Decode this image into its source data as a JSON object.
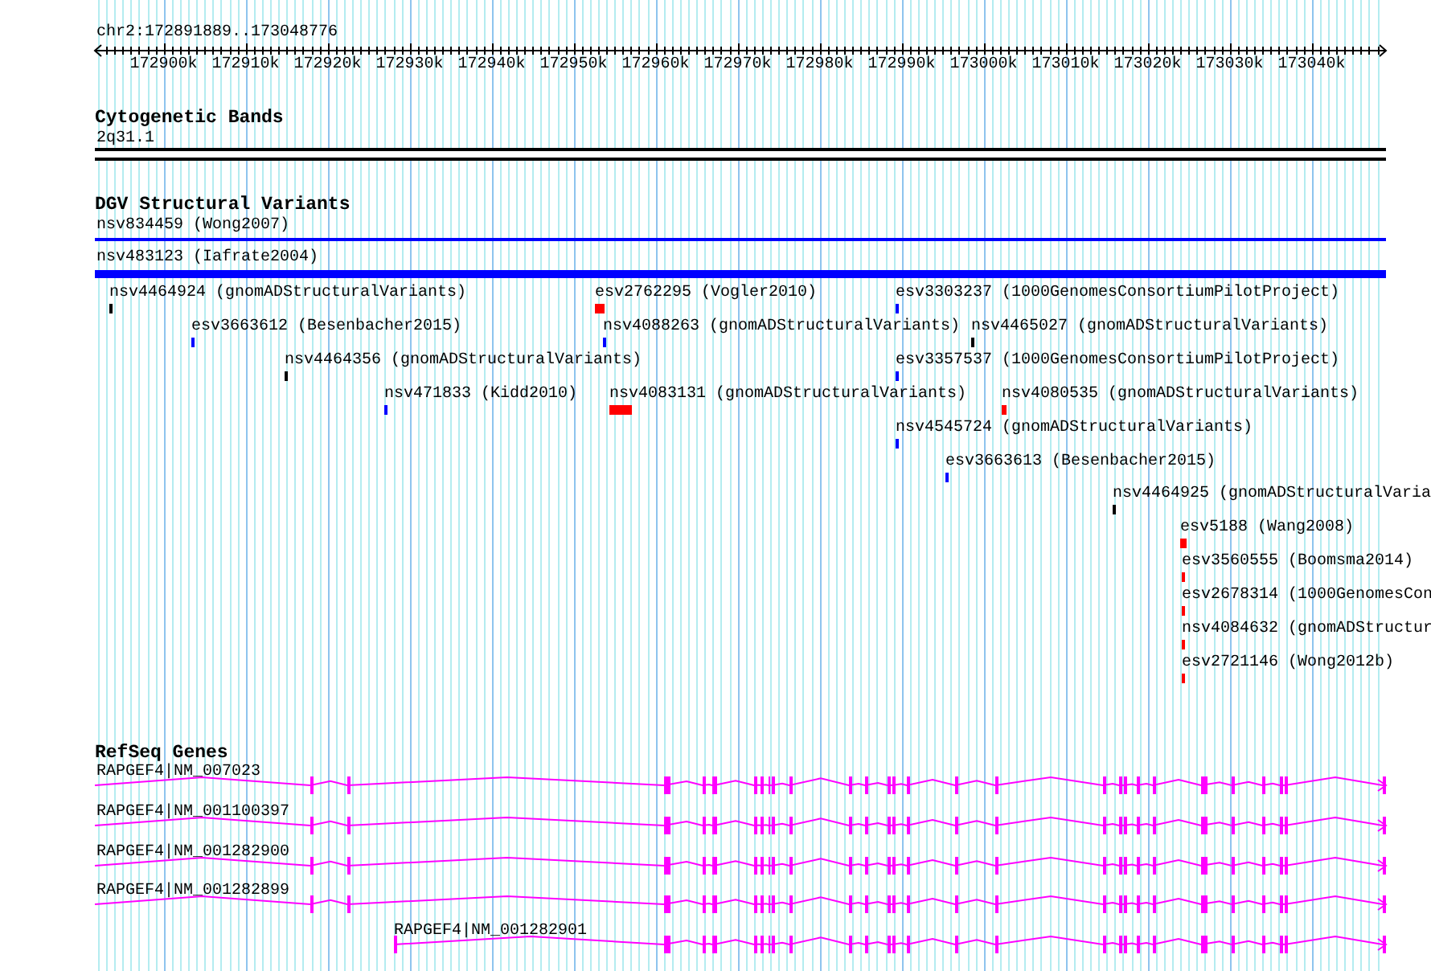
{
  "location": "chr2:172891889..173048776",
  "ruler": {
    "ticks": [
      "172900k",
      "172910k",
      "172920k",
      "172930k",
      "172940k",
      "172950k",
      "172960k",
      "172970k",
      "172980k",
      "172990k",
      "173000k",
      "173010k",
      "173020k",
      "173030k",
      "173040k"
    ]
  },
  "tracks": [
    {
      "kind": "bands",
      "title": "Cytogenetic Bands",
      "features": [
        {
          "label": "2q31.1"
        }
      ]
    },
    {
      "kind": "variants",
      "title": "DGV Structural Variants",
      "features": [
        {
          "label": "nsv834459 (Wong2007)",
          "color": "#0000ff"
        },
        {
          "label": "nsv483123 (Iafrate2004)",
          "color": "#0000ff"
        },
        {
          "label": "nsv4464924 (gnomADStructuralVariants)",
          "color": "#000000"
        },
        {
          "label": "esv2762295 (Vogler2010)",
          "color": "#ff0000"
        },
        {
          "label": "esv3303237 (1000GenomesConsortiumPilotProject)",
          "color": "#0000ff"
        },
        {
          "label": "esv3663612 (Besenbacher2015)",
          "color": "#0000ff"
        },
        {
          "label": "nsv4088263 (gnomADStructuralVariants)",
          "color": "#0000ff"
        },
        {
          "label": "nsv4465027 (gnomADStructuralVariants)",
          "color": "#000000"
        },
        {
          "label": "nsv4464356 (gnomADStructuralVariants)",
          "color": "#000000"
        },
        {
          "label": "esv3357537 (1000GenomesConsortiumPilotProject)",
          "color": "#0000ff"
        },
        {
          "label": "nsv471833 (Kidd2010)",
          "color": "#0000ff"
        },
        {
          "label": "nsv4083131 (gnomADStructuralVariants)",
          "color": "#ff0000"
        },
        {
          "label": "nsv4080535 (gnomADStructuralVariants)",
          "color": "#ff0000"
        },
        {
          "label": "nsv4545724 (gnomADStructuralVariants)",
          "color": "#0000ff"
        },
        {
          "label": "esv3663613 (Besenbacher2015)",
          "color": "#0000ff"
        },
        {
          "label": "nsv4464925 (gnomADStructuralVaria",
          "color": "#000000"
        },
        {
          "label": "esv5188 (Wang2008)",
          "color": "#ff0000"
        },
        {
          "label": "esv3560555 (Boomsma2014)",
          "color": "#ff0000"
        },
        {
          "label": "esv2678314 (1000GenomesCon",
          "color": "#ff0000"
        },
        {
          "label": "nsv4084632 (gnomADStructur",
          "color": "#ff0000"
        },
        {
          "label": "esv2721146 (Wong2012b)",
          "color": "#ff0000"
        }
      ]
    },
    {
      "kind": "genes",
      "title": "RefSeq Genes",
      "features": [
        {
          "label": "RAPGEF4|NM_007023"
        },
        {
          "label": "RAPGEF4|NM_001100397"
        },
        {
          "label": "RAPGEF4|NM_001282900"
        },
        {
          "label": "RAPGEF4|NM_001282899"
        },
        {
          "label": "RAPGEF4|NM_001282901"
        }
      ]
    }
  ]
}
